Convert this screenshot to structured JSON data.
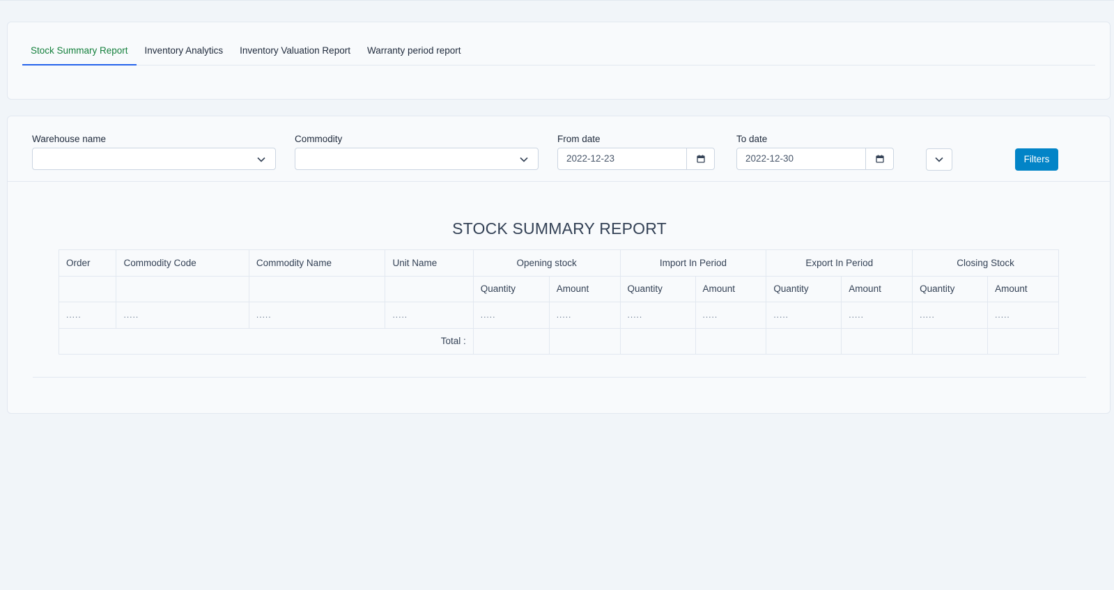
{
  "tabs": [
    {
      "label": "Stock Summary Report",
      "active": true
    },
    {
      "label": "Inventory Analytics",
      "active": false
    },
    {
      "label": "Inventory Valuation Report",
      "active": false
    },
    {
      "label": "Warranty period report",
      "active": false
    }
  ],
  "filters": {
    "warehouse_label": "Warehouse name",
    "warehouse_value": "",
    "commodity_label": "Commodity",
    "commodity_value": "",
    "from_label": "From date",
    "from_value": "2022-12-23",
    "to_label": "To date",
    "to_value": "2022-12-30",
    "extra_select_value": "",
    "button_label": "Filters"
  },
  "report": {
    "title": "STOCK SUMMARY REPORT",
    "headers": {
      "order": "Order",
      "commodity_code": "Commodity Code",
      "commodity_name": "Commodity Name",
      "unit_name": "Unit Name",
      "opening_stock": "Opening stock",
      "import_in_period": "Import In Period",
      "export_in_period": "Export In Period",
      "closing_stock": "Closing Stock"
    },
    "subheaders": [
      "Quantity",
      "Amount",
      "Quantity",
      "Amount",
      "Quantity",
      "Amount",
      "Quantity",
      "Amount"
    ],
    "placeholder_row": [
      ".....",
      ".....",
      ".....",
      ".....",
      ".....",
      ".....",
      ".....",
      ".....",
      ".....",
      ".....",
      ".....",
      "....."
    ],
    "total_label": "Total :",
    "totals": [
      "",
      "",
      "",
      "",
      "",
      "",
      "",
      ""
    ]
  },
  "colors": {
    "active_tab_text": "#15803d",
    "active_tab_underline": "#2563eb",
    "primary_button": "#0284c7",
    "page_background": "#f1f5f9"
  },
  "icons": {
    "dropdown": "chevron-down-icon",
    "date_picker": "calendar-icon"
  }
}
